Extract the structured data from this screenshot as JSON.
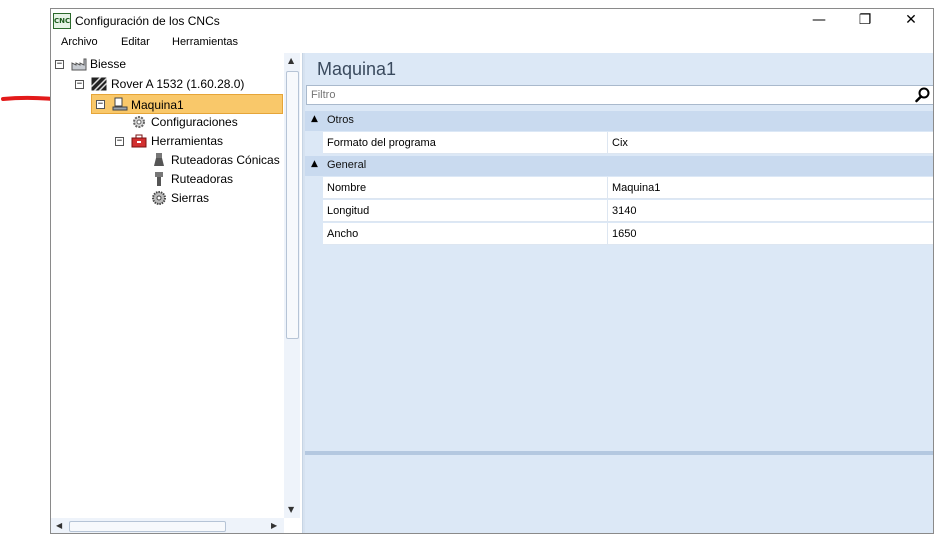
{
  "window": {
    "title": "Configuración de los CNCs",
    "app_icon_text": "CNC",
    "controls": {
      "minimize": "—",
      "maximize": "❐",
      "close": "✕"
    }
  },
  "menu": [
    "Archivo",
    "Editar",
    "Herramientas"
  ],
  "tree": [
    {
      "label": "Biesse",
      "icon": "factory-icon",
      "expander": "−"
    },
    {
      "label": "Rover A 1532 (1.60.28.0)",
      "icon": "machine-stripes-icon",
      "expander": "−"
    },
    {
      "label": "Maquina1",
      "icon": "machine-icon",
      "expander": "−",
      "selected": true
    },
    {
      "label": "Configuraciones",
      "icon": "gear-icon"
    },
    {
      "label": "Herramientas",
      "icon": "toolbox-icon",
      "expander": "−"
    },
    {
      "label": "Ruteadoras Cónicas",
      "icon": "conical-router-icon"
    },
    {
      "label": "Ruteadoras",
      "icon": "router-icon"
    },
    {
      "label": "Sierras",
      "icon": "saw-icon"
    }
  ],
  "right": {
    "heading": "Maquina1",
    "filter_placeholder": "Filtro",
    "categories": [
      {
        "name": "Otros",
        "rows": [
          {
            "name": "Formato del programa",
            "value": "Cix"
          }
        ]
      },
      {
        "name": "General",
        "rows": [
          {
            "name": "Nombre",
            "value": "Maquina1"
          },
          {
            "name": "Longitud",
            "value": "3140"
          },
          {
            "name": "Ancho",
            "value": "1650"
          }
        ]
      }
    ]
  },
  "colors": {
    "accent": "#f9c86a",
    "panel": "#dce8f6",
    "category": "#c9daef",
    "arrow": "#e31a1a"
  }
}
